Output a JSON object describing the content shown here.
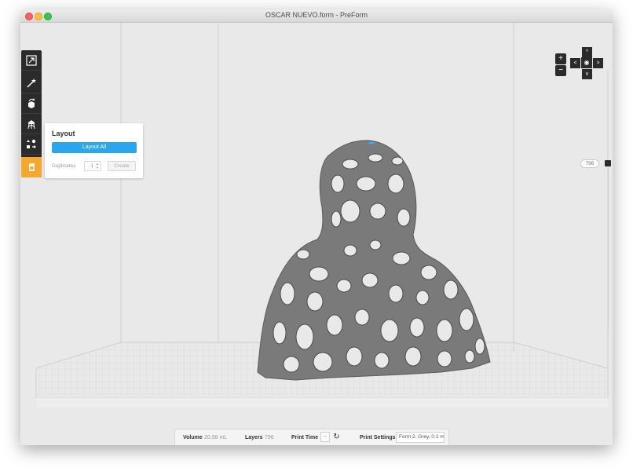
{
  "window": {
    "title": "OSCAR NUEVO.form - PreForm"
  },
  "toolbar": {
    "tools": [
      {
        "icon": "fit-view-icon"
      },
      {
        "icon": "magic-wand-icon"
      },
      {
        "icon": "orientation-icon"
      },
      {
        "icon": "supports-icon"
      },
      {
        "icon": "layout-icon"
      },
      {
        "icon": "print-icon",
        "active": true
      }
    ],
    "accent_color": "#f7a72c"
  },
  "layout_panel": {
    "title": "Layout",
    "layout_all_label": "Layout All",
    "duplicates_label": "Duplicates",
    "duplicates_value": "1",
    "create_label": "Create",
    "button_color": "#2aa5ee"
  },
  "view_controls": {
    "zoom_in": "+",
    "zoom_out": "−",
    "up": "^",
    "down": "v",
    "left": "<",
    "right": ">"
  },
  "layer_slider": {
    "value": "796"
  },
  "status_bar": {
    "volume_label": "Volume",
    "volume_value": "20.98 mL",
    "layers_label": "Layers",
    "layers_value": "796",
    "print_time_label": "Print Time",
    "print_time_value": "--",
    "print_settings_label": "Print Settings",
    "print_settings_value": "Form 2, Grey, 0.1 mm"
  },
  "model": {
    "color": "#7a7a7a"
  }
}
